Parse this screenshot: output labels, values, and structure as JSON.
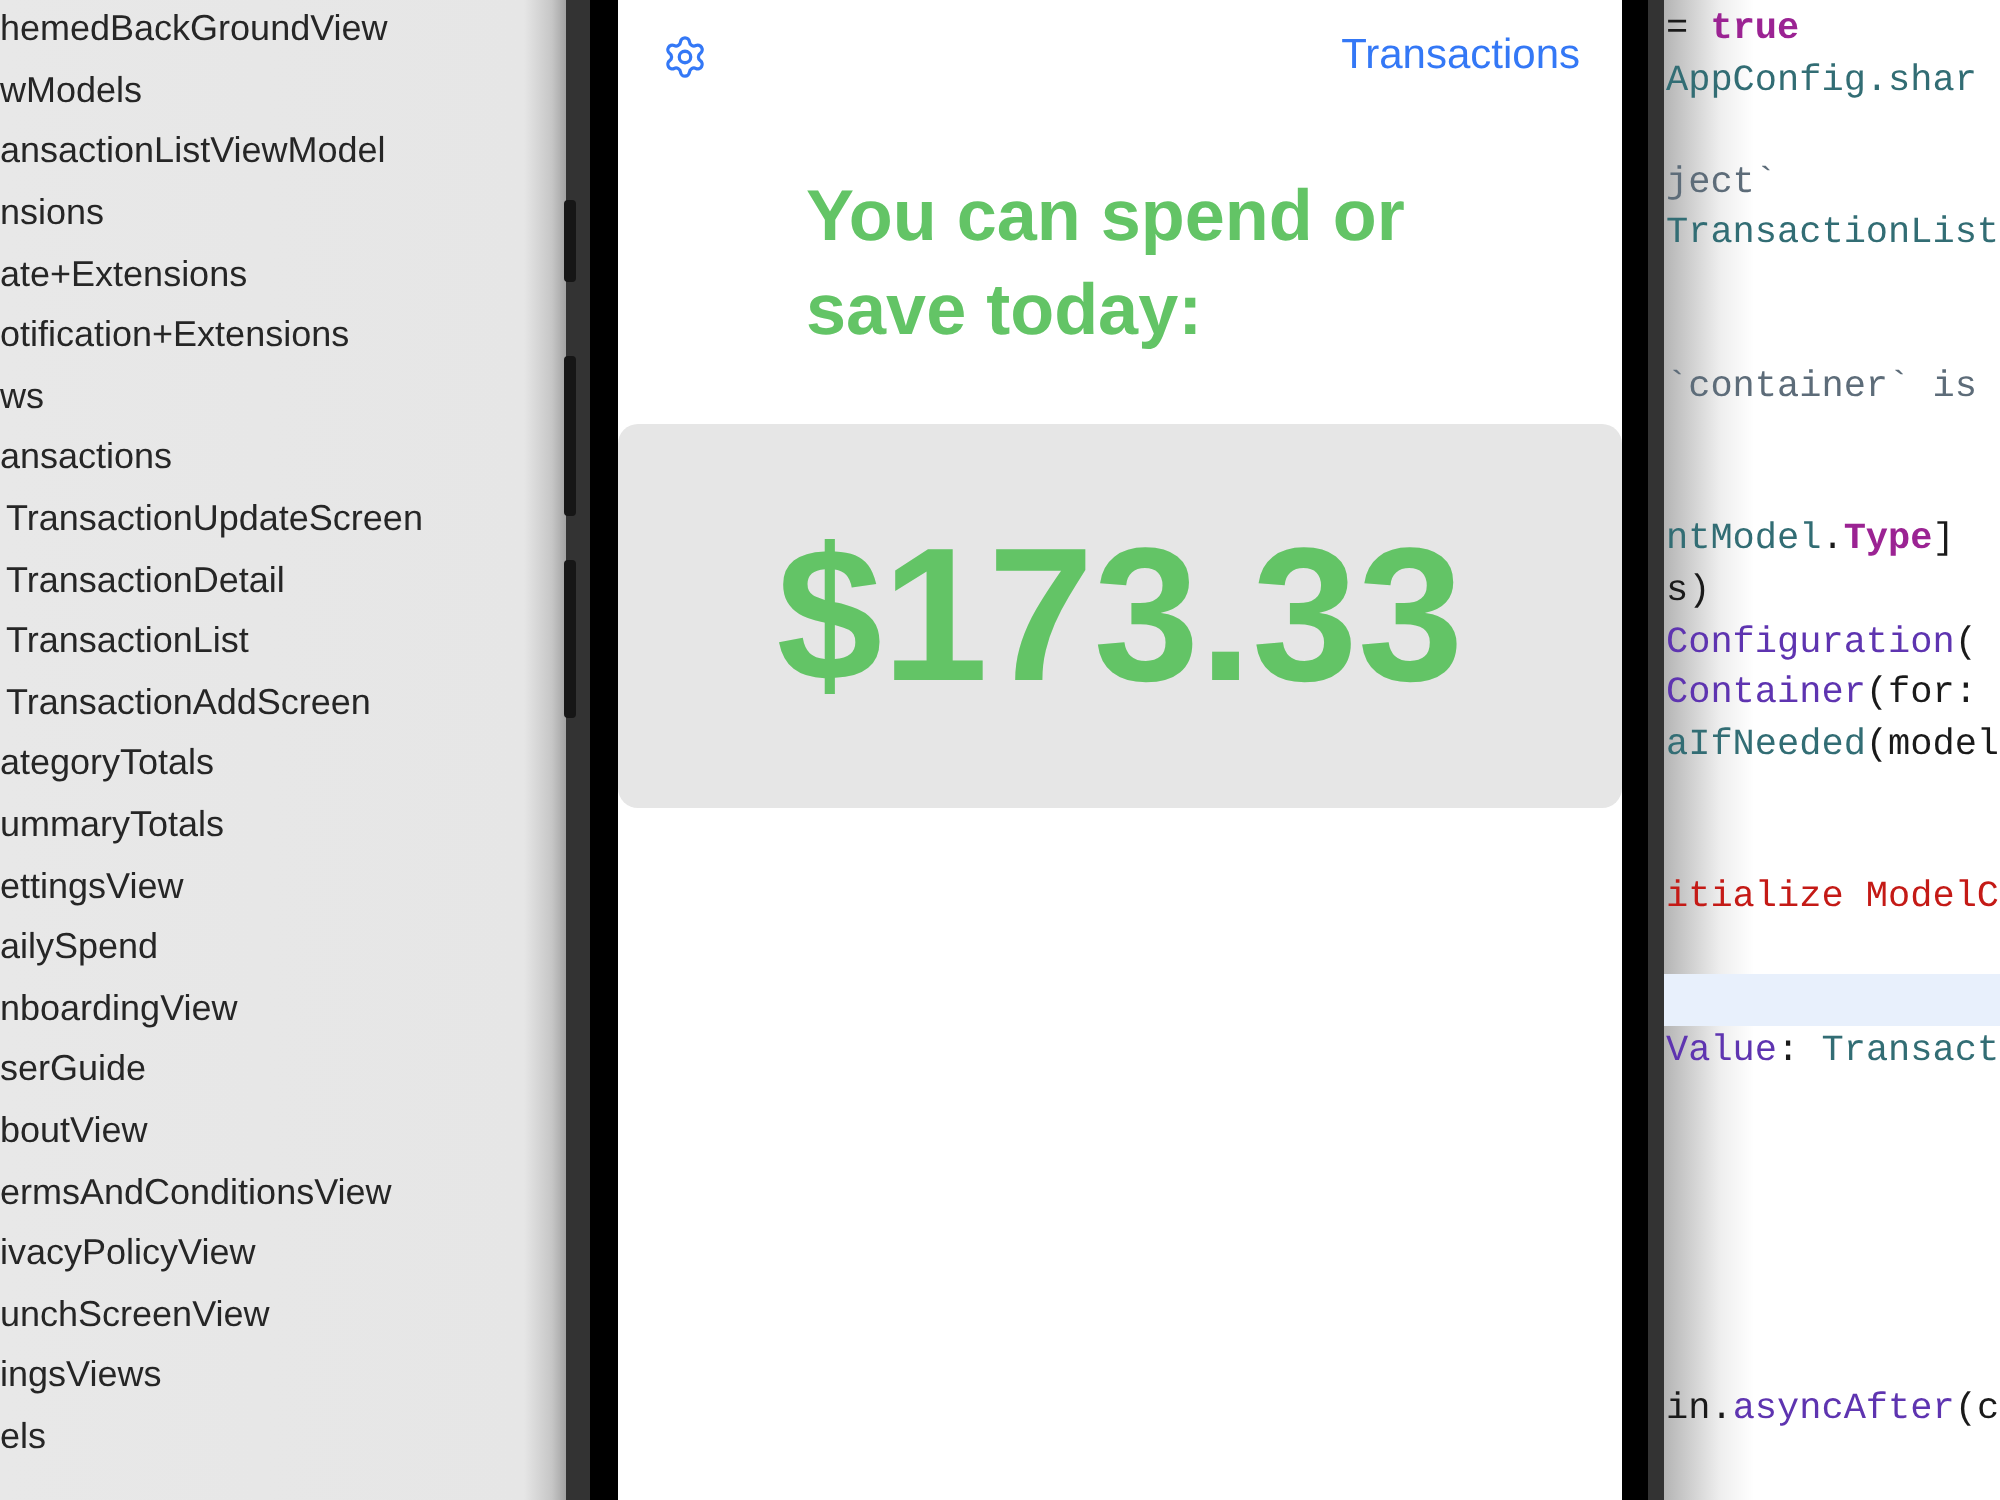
{
  "sidebar": {
    "items": [
      {
        "label": "hemedBackGroundView"
      },
      {
        "label": "wModels"
      },
      {
        "label": "ansactionListViewModel"
      },
      {
        "label": "nsions"
      },
      {
        "label": "ate+Extensions"
      },
      {
        "label": "otification+Extensions"
      },
      {
        "label": "ws"
      },
      {
        "label": "ansactions",
        "children": [
          {
            "label": "TransactionUpdateScreen"
          },
          {
            "label": "TransactionDetail"
          },
          {
            "label": "TransactionList"
          },
          {
            "label": "TransactionAddScreen"
          }
        ]
      },
      {
        "label": "ategoryTotals"
      },
      {
        "label": "ummaryTotals"
      },
      {
        "label": "ettingsView"
      },
      {
        "label": "ailySpend"
      },
      {
        "label": "nboardingView"
      },
      {
        "label": "serGuide"
      },
      {
        "label": "boutView"
      },
      {
        "label": "ermsAndConditionsView"
      },
      {
        "label": "ivacyPolicyView"
      },
      {
        "label": "unchScreenView"
      },
      {
        "label": "ingsViews"
      },
      {
        "label": "els"
      }
    ]
  },
  "simulator": {
    "nav_bar": {
      "trailing_link": "Transactions"
    },
    "headline": "You can spend or save today:",
    "amount": "$173.33"
  },
  "editor": {
    "lines": [
      {
        "kind": "code",
        "current": false,
        "tokens": [
          {
            "text": "= ",
            "kind": "plain"
          },
          {
            "text": "true",
            "kind": "keyword"
          }
        ]
      },
      {
        "kind": "code",
        "current": false,
        "tokens": [
          {
            "text": "AppConfig.shar",
            "kind": "type"
          }
        ]
      },
      {
        "kind": "blank",
        "current": false
      },
      {
        "kind": "code",
        "current": false,
        "tokens": [
          {
            "text": "ject`",
            "kind": "comment"
          }
        ]
      },
      {
        "kind": "code",
        "current": false,
        "tokens": [
          {
            "text": "TransactionList",
            "kind": "type"
          }
        ]
      },
      {
        "kind": "blank",
        "current": false
      },
      {
        "kind": "blank",
        "current": false
      },
      {
        "kind": "code",
        "current": false,
        "tokens": [
          {
            "text": "`container` is",
            "kind": "comment"
          }
        ]
      },
      {
        "kind": "blank",
        "current": false
      },
      {
        "kind": "blank",
        "current": false
      },
      {
        "kind": "code",
        "current": false,
        "tokens": [
          {
            "text": "ntModel",
            "kind": "type"
          },
          {
            "text": ".",
            "kind": "plain"
          },
          {
            "text": "Type",
            "kind": "keyword"
          },
          {
            "text": "]",
            "kind": "plain"
          }
        ]
      },
      {
        "kind": "code",
        "current": false,
        "tokens": [
          {
            "text": "s)",
            "kind": "plain"
          }
        ]
      },
      {
        "kind": "code",
        "current": false,
        "tokens": [
          {
            "text": "Configuration",
            "kind": "other"
          },
          {
            "text": "(",
            "kind": "plain"
          }
        ]
      },
      {
        "kind": "code",
        "current": false,
        "tokens": [
          {
            "text": "Container",
            "kind": "other"
          },
          {
            "text": "(for:",
            "kind": "plain"
          }
        ]
      },
      {
        "kind": "code",
        "current": false,
        "tokens": [
          {
            "text": "aIfNeeded",
            "kind": "type"
          },
          {
            "text": "(model",
            "kind": "plain"
          }
        ]
      },
      {
        "kind": "blank",
        "current": false
      },
      {
        "kind": "blank",
        "current": false
      },
      {
        "kind": "code",
        "current": false,
        "tokens": [
          {
            "text": "itialize ModelC",
            "kind": "string"
          }
        ]
      },
      {
        "kind": "blank",
        "current": false
      },
      {
        "kind": "blank",
        "current": true
      },
      {
        "kind": "code",
        "current": false,
        "tokens": [
          {
            "text": "Value",
            "kind": "other"
          },
          {
            "text": ": ",
            "kind": "plain"
          },
          {
            "text": "Transact",
            "kind": "type"
          }
        ]
      },
      {
        "kind": "blank",
        "current": false
      },
      {
        "kind": "blank",
        "current": false
      },
      {
        "kind": "blank",
        "current": false
      },
      {
        "kind": "blank",
        "current": false
      },
      {
        "kind": "blank",
        "current": false
      },
      {
        "kind": "blank",
        "current": false
      },
      {
        "kind": "code",
        "current": false,
        "tokens": [
          {
            "text": "in.",
            "kind": "plain"
          },
          {
            "text": "asyncAfter",
            "kind": "other"
          },
          {
            "text": "(c",
            "kind": "plain"
          }
        ]
      }
    ]
  }
}
